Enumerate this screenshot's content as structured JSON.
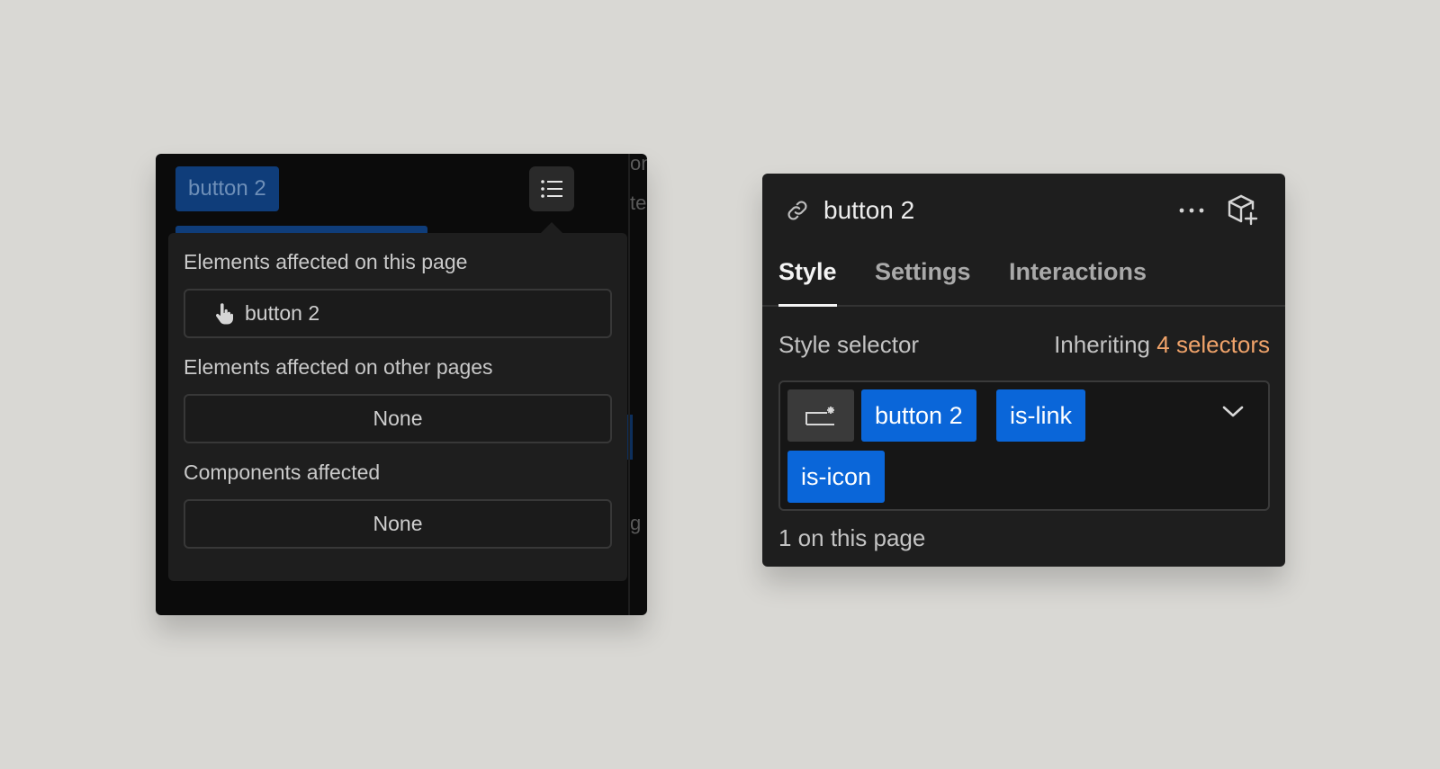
{
  "left_panel": {
    "background_chip_label": "button 2",
    "background_fragments": [
      "on",
      "te",
      "g"
    ],
    "list_button_icon": "list-icon",
    "sections": [
      {
        "label": "Elements affected on this page",
        "value": "button 2",
        "icon": "hand-pointer-icon"
      },
      {
        "label": "Elements affected on other pages",
        "value": "None"
      },
      {
        "label": "Components affected",
        "value": "None"
      }
    ]
  },
  "right_panel": {
    "title": "button 2",
    "link_icon": "link-icon",
    "more_icon": "more-horizontal-icon",
    "component_icon": "add-component-cube-icon",
    "tabs": [
      {
        "label": "Style",
        "active": true
      },
      {
        "label": "Settings",
        "active": false
      },
      {
        "label": "Interactions",
        "active": false
      }
    ],
    "style_selector_label": "Style selector",
    "inheriting_label": "Inheriting",
    "inheriting_count": "4 selectors",
    "selector_chips": [
      "button 2",
      "is-link",
      "is-icon"
    ],
    "count_text": "1 on this page"
  },
  "colors": {
    "background": "#d9d8d4",
    "panel": "#1e1e1e",
    "chip_blue": "#0a66d9",
    "accent_orange": "#f0a36a"
  }
}
